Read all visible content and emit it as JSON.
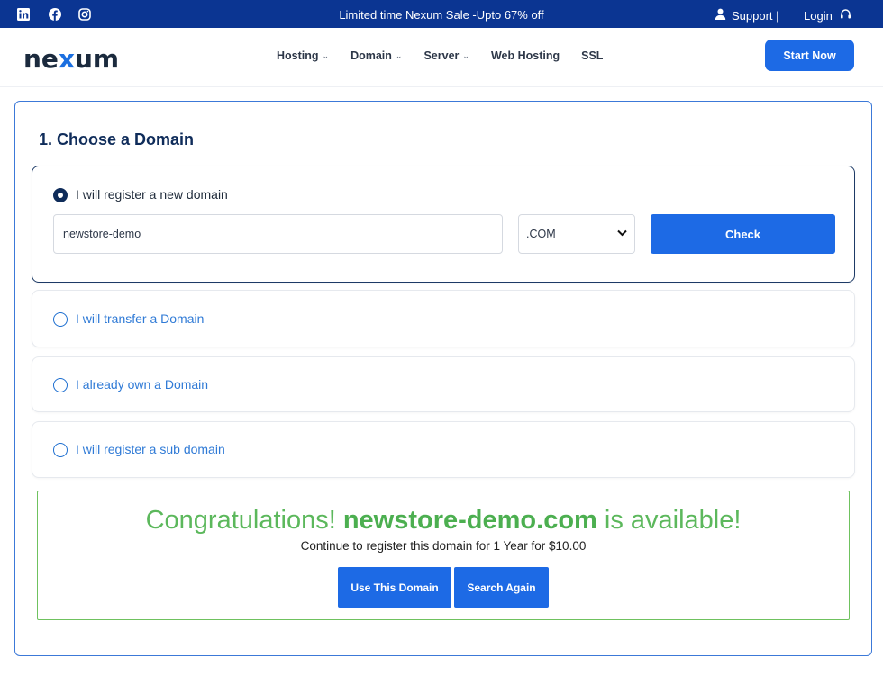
{
  "topbar": {
    "promo": "Limited time Nexum Sale -Upto 67% off",
    "support": "Support |",
    "login": "Login",
    "social_icons": [
      "linkedin-icon",
      "facebook-icon",
      "instagram-icon"
    ]
  },
  "header": {
    "logo_pre": "ne",
    "logo_x": "x",
    "logo_post": "um",
    "nav": [
      {
        "label": "Hosting",
        "has_dropdown": true
      },
      {
        "label": "Domain",
        "has_dropdown": true
      },
      {
        "label": "Server",
        "has_dropdown": true
      },
      {
        "label": "Web Hosting",
        "has_dropdown": false
      },
      {
        "label": "SSL",
        "has_dropdown": false
      }
    ],
    "cta": "Start Now"
  },
  "section": {
    "title": "1. Choose a Domain"
  },
  "options": [
    {
      "label": "I will register a new domain",
      "selected": true
    },
    {
      "label": "I will transfer a Domain",
      "selected": false
    },
    {
      "label": "I already own a Domain",
      "selected": false
    },
    {
      "label": "I will register a sub domain",
      "selected": false
    }
  ],
  "search": {
    "domain_value": "newstore-demo",
    "tld_selected": ".COM",
    "check_label": "Check"
  },
  "result": {
    "prefix": "Congratulations!",
    "domain": "newstore-demo.com",
    "suffix": "is available!",
    "continue_text": "Continue to register this domain for 1 Year for $10.00",
    "use_btn": "Use This Domain",
    "search_again_btn": "Search Again"
  },
  "colors": {
    "topbar": "#0b3592",
    "primary": "#1d6ae5",
    "success": "#5cb85c",
    "heading": "#0f2c5a"
  }
}
